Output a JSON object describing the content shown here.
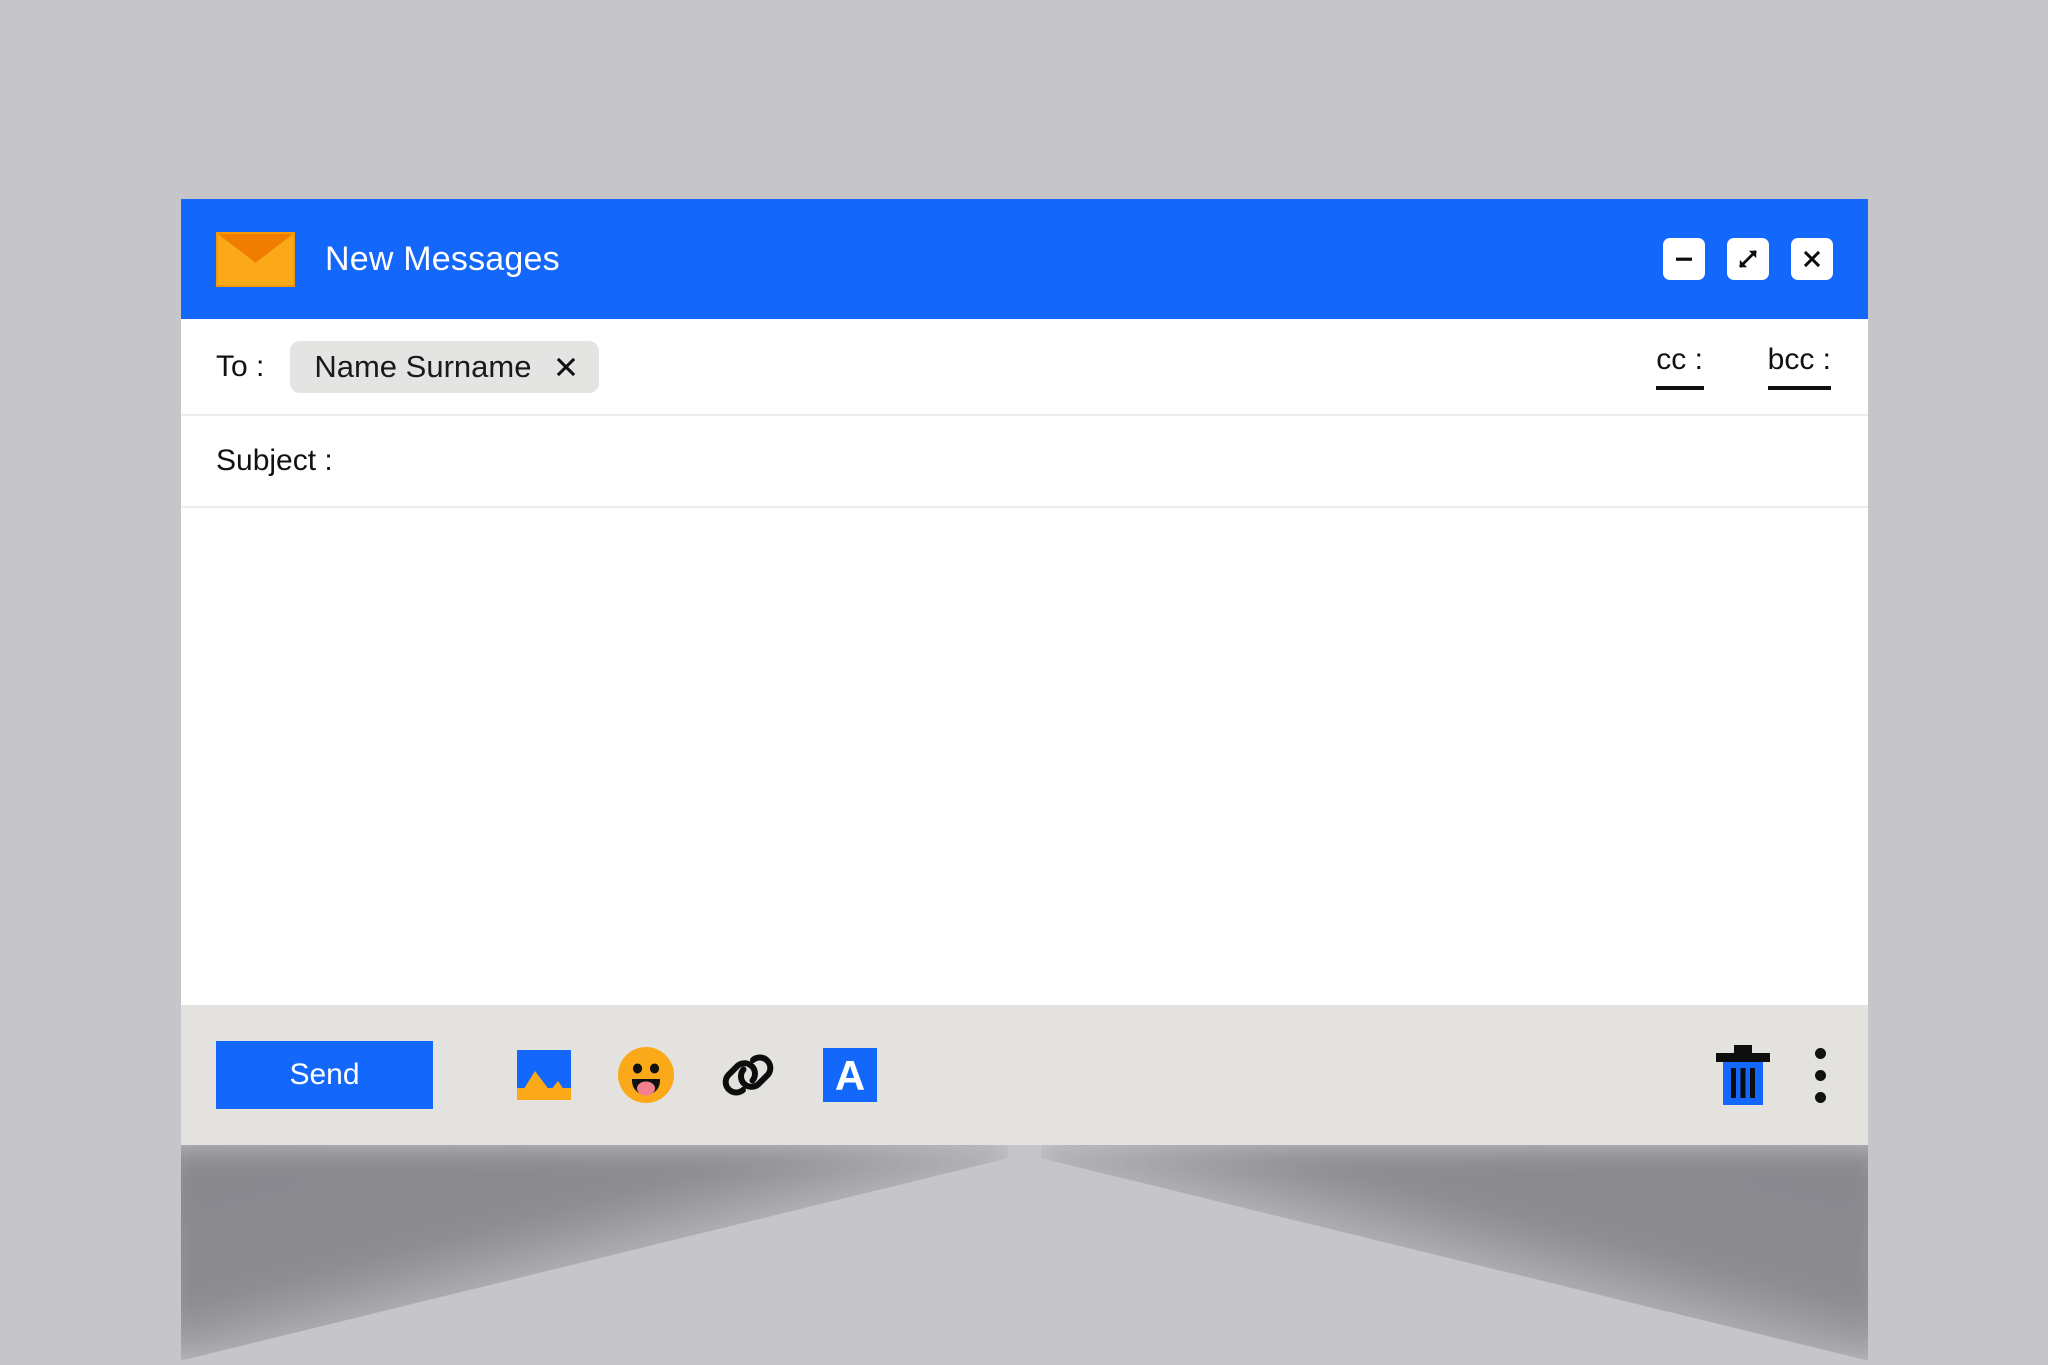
{
  "window": {
    "title": "New Messages",
    "app_icon": "envelope-icon",
    "controls": [
      {
        "name": "minimize",
        "icon": "minimize-icon"
      },
      {
        "name": "maximize",
        "icon": "expand-diagonal-icon"
      },
      {
        "name": "close",
        "icon": "close-icon"
      }
    ]
  },
  "compose": {
    "to_label": "To :",
    "recipient": {
      "name": "Name Surname",
      "remove_icon": "close-icon"
    },
    "cc_label": "cc :",
    "bcc_label": "bcc :",
    "subject_label": "Subject :",
    "subject_value": "",
    "body_value": "",
    "body_placeholder": ""
  },
  "toolbar": {
    "send_label": "Send",
    "tools": [
      {
        "name": "insert-image",
        "icon": "image-icon"
      },
      {
        "name": "insert-emoji",
        "icon": "emoji-icon"
      },
      {
        "name": "attach-link",
        "icon": "link-icon"
      },
      {
        "name": "formatting-options",
        "icon": "font-format-icon",
        "glyph": "A"
      }
    ],
    "discard": {
      "name": "discard-draft",
      "icon": "trash-icon"
    },
    "more": {
      "name": "more-options",
      "icon": "kebab-menu-icon"
    }
  },
  "colors": {
    "accent_blue": "#1368fb",
    "envelope_orange": "#fba919",
    "envelope_flap": "#f07c00",
    "footer_gray": "#e4e2de",
    "chip_gray": "#e4e4e2",
    "page_background": "#c6c6ca"
  }
}
